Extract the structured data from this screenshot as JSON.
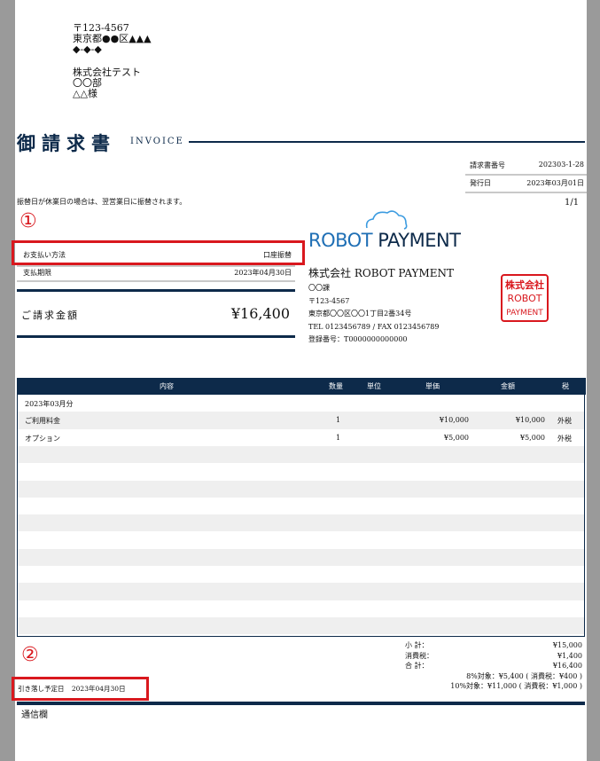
{
  "recipient": {
    "postal": "〒123-4567",
    "address1": "東京都●●区▲▲▲",
    "address2": "◆-◆-◆",
    "company": "株式会社テスト",
    "department": "〇〇部",
    "name": "△△様"
  },
  "header": {
    "title": "御請求書",
    "subtitle": "INVOICE"
  },
  "meta": {
    "invoice_no_label": "請求書番号",
    "invoice_no": "202303-1-28",
    "issue_date_label": "発行日",
    "issue_date": "2023年03月01日",
    "page": "1/1"
  },
  "notice": "振替日が休業日の場合は、翌営業日に振替されます。",
  "annotations": {
    "marker1": "①",
    "marker2": "②",
    "color": "#d9181e"
  },
  "payment": {
    "method_label": "お支払い方法",
    "method_value": "口座振替",
    "deadline_label": "支払期限",
    "deadline_value": "2023年04月30日",
    "total_label": "ご請求金額",
    "total_value": "¥16,400"
  },
  "issuer": {
    "logo_text_1": "ROBOT",
    "logo_text_2": "PAYMENT",
    "company": "株式会社 ROBOT PAYMENT",
    "section": "〇〇課",
    "postal": "〒123-4567",
    "address": "東京都〇〇区〇〇1丁目2番34号",
    "tel_fax": "TEL 0123456789 / FAX 0123456789",
    "registration": "登録番号：T0000000000000",
    "stamp_lines": [
      "株式会社",
      "ROBOT",
      "PAYMENT"
    ]
  },
  "table": {
    "headers": {
      "item": "内容",
      "qty": "数量",
      "unit": "単位",
      "price": "単価",
      "amount": "金額",
      "tax": "税"
    },
    "period": "2023年03月分",
    "rows": [
      {
        "item": "ご利用料金",
        "qty": "1",
        "unit": "",
        "price": "¥10,000",
        "amount": "¥10,000",
        "tax": "外税"
      },
      {
        "item": "オプション",
        "qty": "1",
        "unit": "",
        "price": "¥5,000",
        "amount": "¥5,000",
        "tax": "外税"
      }
    ]
  },
  "summary": {
    "subtotal_label": "小 計：",
    "subtotal_value": "¥15,000",
    "tax_label": "消費税：",
    "tax_value": "¥1,400",
    "total_label": "合 計：",
    "total_value": "¥16,400",
    "breakdown_8": "8%対象：¥5,400 ( 消費税：¥400 )",
    "breakdown_10": "10%対象：¥11,000 ( 消費税：¥1,000 )"
  },
  "debit": {
    "label": "引き落し予定日",
    "value": "2023年04月30日"
  },
  "memo_label": "通信欄",
  "colors": {
    "navy": "#0d2a4a",
    "logo_blue": "#1f6fb5",
    "stamp_red": "#d9181e",
    "stripe": "#efefef"
  }
}
